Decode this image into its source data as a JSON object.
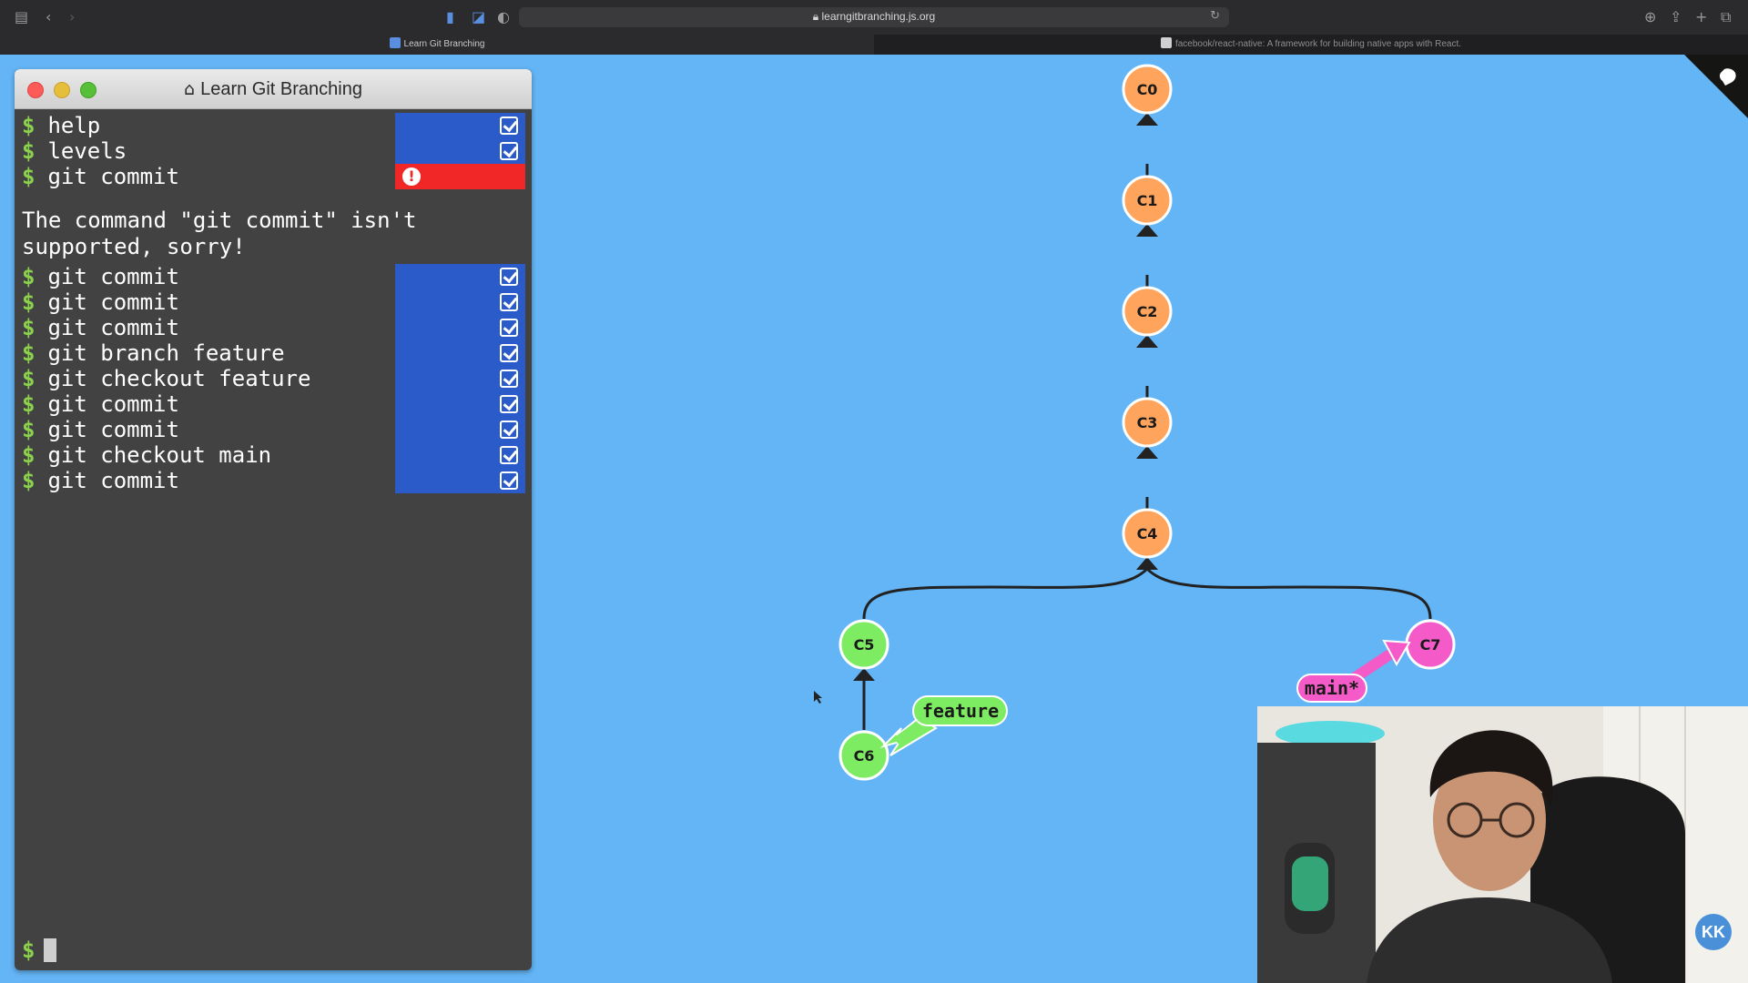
{
  "browser": {
    "url": "learngitbranching.js.org",
    "tabs": [
      {
        "label": "Learn Git Branching",
        "active": true
      },
      {
        "label": "facebook/react-native: A framework for building native apps with React.",
        "active": false
      }
    ]
  },
  "terminal": {
    "title": "Learn Git Branching",
    "prompt_symbol": "$",
    "history_top": [
      {
        "command": "help",
        "status": "ok"
      },
      {
        "command": "levels",
        "status": "ok"
      },
      {
        "command": "git commit",
        "status": "error"
      }
    ],
    "error_message": "The command \"git commit\" isn't supported, sorry!",
    "history_bottom": [
      {
        "command": "git commit",
        "status": "ok"
      },
      {
        "command": "git commit",
        "status": "ok"
      },
      {
        "command": "git commit",
        "status": "ok"
      },
      {
        "command": "git branch feature",
        "status": "ok"
      },
      {
        "command": "git checkout feature",
        "status": "ok"
      },
      {
        "command": "git commit",
        "status": "ok"
      },
      {
        "command": "git commit",
        "status": "ok"
      },
      {
        "command": "git checkout main",
        "status": "ok"
      },
      {
        "command": "git commit",
        "status": "ok"
      }
    ],
    "input_value": ""
  },
  "graph": {
    "commits": [
      {
        "id": "C0",
        "branch": "main"
      },
      {
        "id": "C1",
        "branch": "main"
      },
      {
        "id": "C2",
        "branch": "main"
      },
      {
        "id": "C3",
        "branch": "main"
      },
      {
        "id": "C4",
        "branch": "main"
      },
      {
        "id": "C5",
        "branch": "feature"
      },
      {
        "id": "C6",
        "branch": "feature"
      },
      {
        "id": "C7",
        "branch": "main"
      }
    ],
    "branches": [
      {
        "name": "feature",
        "target": "C6",
        "color": "#7dec63"
      },
      {
        "name": "main*",
        "target": "C7",
        "color": "#f45ac8"
      }
    ],
    "colors": {
      "background": "#64b5f6",
      "base_commit": "#ffa45c",
      "feature_commit": "#7dec63",
      "main_head_commit": "#f45ac8",
      "edge": "#222222"
    }
  },
  "webcam": {
    "badge": "KK"
  }
}
